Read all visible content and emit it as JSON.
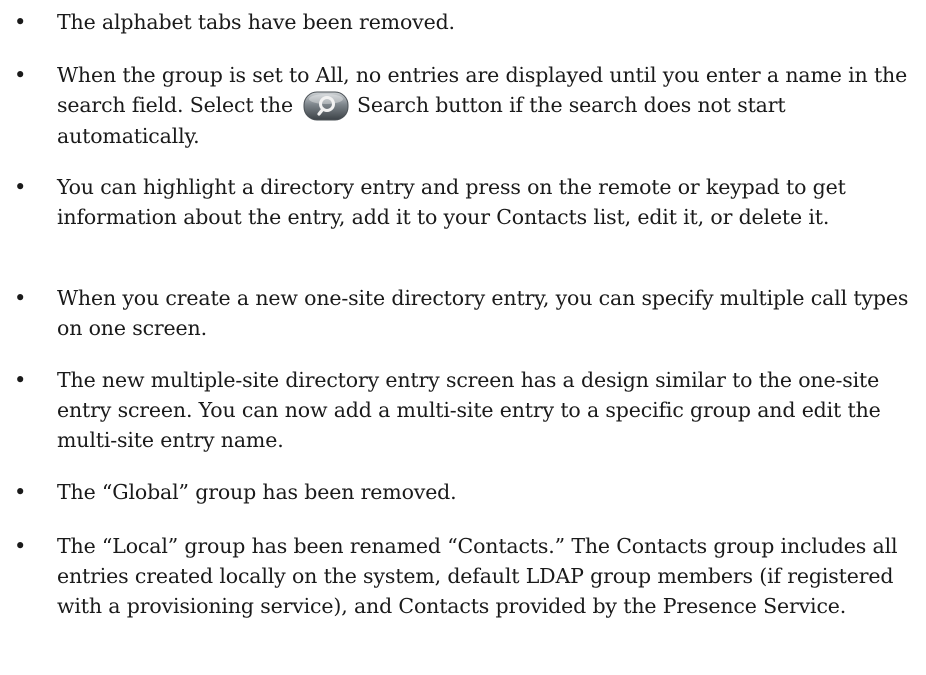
{
  "bullets": [
    {
      "text": "The alphabet tabs have been removed."
    },
    {
      "before_icon": "When the group is set to All, no entries are displayed until you enter a name in the search field. Select the",
      "icon": "search-icon",
      "after_icon": "Search button if the search does not start automatically."
    },
    {
      "text": "You can highlight a directory entry and press on the remote or keypad to get information about the entry, add it to your Contacts list, edit it, or delete it."
    },
    {
      "text": "When you create a new one-site directory entry, you can specify multiple call types on one screen."
    },
    {
      "text": "The new multiple-site directory entry screen has a design similar to the one-site entry screen. You can now add a multi-site entry to a specific group and edit the multi-site entry name."
    },
    {
      "text": "The “Global” group has been removed."
    },
    {
      "text": "The “Local” group has been renamed “Contacts.” The Contacts group includes all entries created locally on the system, default LDAP group members (if registered with a provisioning service), and Contacts provided by the Presence Service."
    }
  ],
  "bullet_symbol": "•"
}
